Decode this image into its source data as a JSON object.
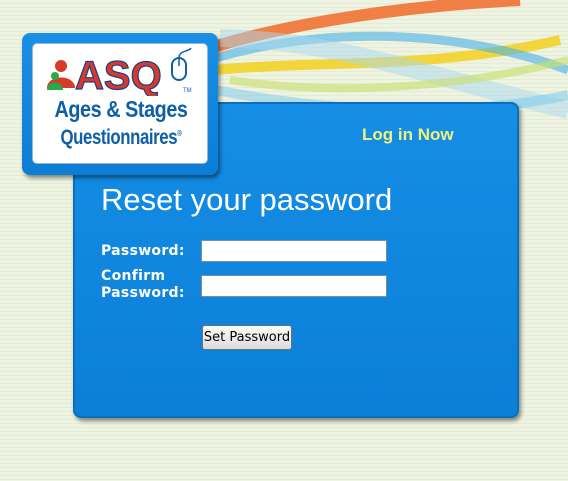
{
  "logo": {
    "brand": "ASQ",
    "trademark": "TM",
    "line1": "Ages & Stages",
    "line2": "Questionnaires",
    "registered": "®"
  },
  "nav": {
    "login_label": "Log in Now"
  },
  "form": {
    "title": "Reset your password",
    "password_label": "Password:",
    "confirm_label_line1": "Confirm",
    "confirm_label_line2": "Password:",
    "password_value": "",
    "confirm_value": "",
    "submit_label": "Set Password"
  },
  "colors": {
    "panel_blue": "#0b7fd8",
    "link_yellow": "#f2f27a",
    "logo_text_blue": "#0e5fa8",
    "background": "#eef3e2"
  },
  "icons": [
    "family-icon",
    "computer-mouse-icon",
    "swoosh-decoration"
  ]
}
